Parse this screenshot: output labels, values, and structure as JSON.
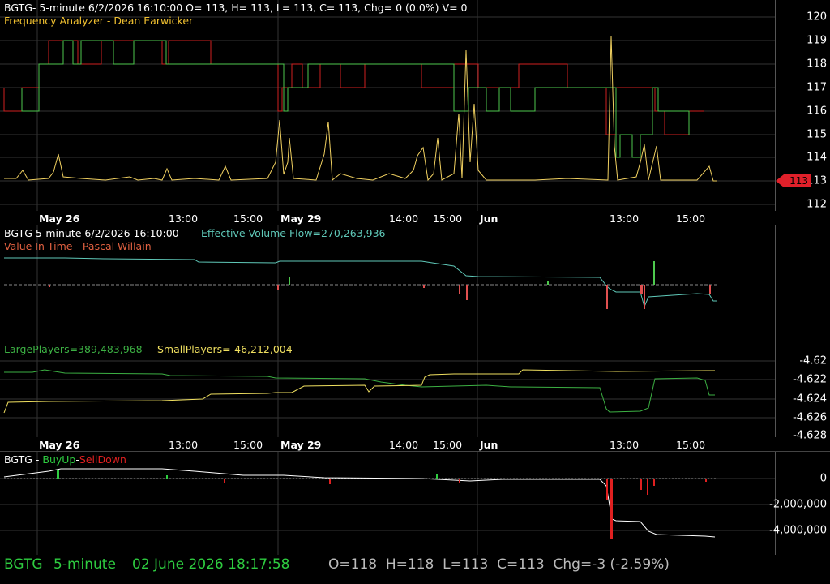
{
  "price_pane": {
    "header": "BGTG- 5-minute 6/2/2026 16:10:00 O= 113, H= 113, L= 113, C= 113, Chg= 0 (0.0%) V= 0",
    "indicator": "Frequency Analyzer - Dean Earwicker",
    "y_ticks": [
      "120",
      "119",
      "118",
      "117",
      "116",
      "115",
      "114",
      "113",
      "112"
    ],
    "last_price": "113",
    "colors": {
      "step_up": "#4ec94e",
      "step_down": "#d02020",
      "price": "#f0d060"
    }
  },
  "time_axis": {
    "labels": [
      "May 26",
      "13:00",
      "15:00",
      "May 29",
      "14:00",
      "15:00",
      "Jun",
      "13:00",
      "15:00"
    ],
    "bold": [
      true,
      false,
      false,
      true,
      false,
      false,
      true,
      false,
      false
    ]
  },
  "flow_pane": {
    "symbol": "BGTG 5-minute  6/2/2026 16:10:00",
    "value_label": "Effective Volume Flow=270,263,936",
    "indicator": "Value In Time - Pascal Willain",
    "colors": {
      "line": "#5fc8b8",
      "up": "#4ec94e",
      "down": "#e05050"
    }
  },
  "players_pane": {
    "large_label": "LargePlayers=389,483,968",
    "small_label": "SmallPlayers=-46,212,004",
    "y_ticks": [
      "-4.62",
      "-4.622",
      "-4.624",
      "-4.626",
      "-4.628"
    ],
    "colors": {
      "large": "#3cb043",
      "small": "#f0e060"
    }
  },
  "buysell_pane": {
    "symbol": "BGTG - ",
    "buy_label": "BuyUp",
    "dash": "-",
    "sell_label": "SellDown",
    "y_ticks": [
      "0",
      "-2,000,000",
      "-4,000,000"
    ],
    "colors": {
      "buy": "#2ecc40",
      "sell": "#e02020"
    }
  },
  "status_bar": {
    "symbol": "BGTG",
    "interval": "5-minute",
    "datetime": "02 June 2026 18:17:58",
    "ohlc": "O=118  H=118  L=113  C=113  Chg=-3 (-2.59%)"
  }
}
